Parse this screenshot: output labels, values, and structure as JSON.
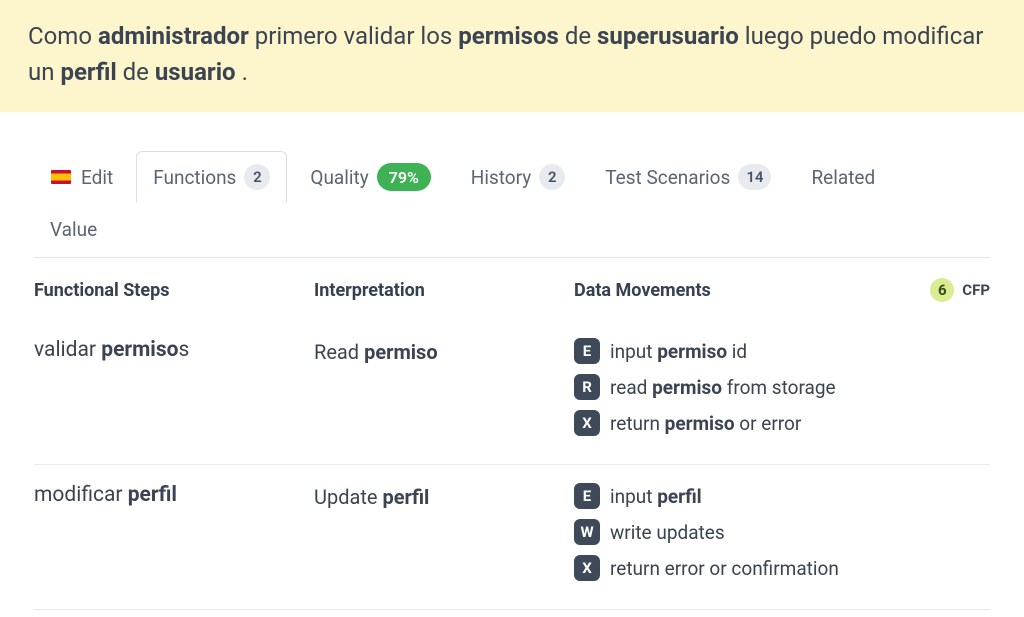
{
  "banner": {
    "parts": [
      {
        "t": "Como ",
        "b": false
      },
      {
        "t": "administrador",
        "b": true
      },
      {
        "t": " primero validar los ",
        "b": false
      },
      {
        "t": "permisos",
        "b": true
      },
      {
        "t": " de ",
        "b": false
      },
      {
        "t": "superusuario",
        "b": true
      },
      {
        "t": " luego puedo modificar un ",
        "b": false
      },
      {
        "t": "perfil",
        "b": true
      },
      {
        "t": " de ",
        "b": false
      },
      {
        "t": "usuario",
        "b": true
      },
      {
        "t": " .",
        "b": false
      }
    ]
  },
  "tabs": {
    "edit": "Edit",
    "functions": {
      "label": "Functions",
      "count": "2"
    },
    "quality": {
      "label": "Quality",
      "pct": "79%"
    },
    "history": {
      "label": "History",
      "count": "2"
    },
    "test": {
      "label": "Test Scenarios",
      "count": "14"
    },
    "related": "Related",
    "value": "Value"
  },
  "headers": {
    "steps": "Functional Steps",
    "interp": "Interpretation",
    "dm": "Data Movements",
    "cfp_count": "6",
    "cfp_label": "CFP"
  },
  "rows": [
    {
      "step": [
        {
          "t": "validar ",
          "b": false
        },
        {
          "t": "permiso",
          "b": true
        },
        {
          "t": "s",
          "b": false
        }
      ],
      "interp": [
        {
          "t": "Read ",
          "b": false
        },
        {
          "t": "permiso",
          "b": true
        }
      ],
      "dm": [
        {
          "chip": "E",
          "parts": [
            {
              "t": "input ",
              "b": false
            },
            {
              "t": "permiso",
              "b": true
            },
            {
              "t": " id",
              "b": false
            }
          ]
        },
        {
          "chip": "R",
          "parts": [
            {
              "t": "read ",
              "b": false
            },
            {
              "t": "permiso",
              "b": true
            },
            {
              "t": " from storage",
              "b": false
            }
          ]
        },
        {
          "chip": "X",
          "parts": [
            {
              "t": "return ",
              "b": false
            },
            {
              "t": "permiso",
              "b": true
            },
            {
              "t": " or error",
              "b": false
            }
          ]
        }
      ]
    },
    {
      "step": [
        {
          "t": "modificar ",
          "b": false
        },
        {
          "t": "perfil",
          "b": true
        }
      ],
      "interp": [
        {
          "t": "Update ",
          "b": false
        },
        {
          "t": "perfil",
          "b": true
        }
      ],
      "dm": [
        {
          "chip": "E",
          "parts": [
            {
              "t": "input ",
              "b": false
            },
            {
              "t": "perfil",
              "b": true
            }
          ]
        },
        {
          "chip": "W",
          "parts": [
            {
              "t": "write updates",
              "b": false
            }
          ]
        },
        {
          "chip": "X",
          "parts": [
            {
              "t": "return error or confirmation",
              "b": false
            }
          ]
        }
      ]
    }
  ]
}
